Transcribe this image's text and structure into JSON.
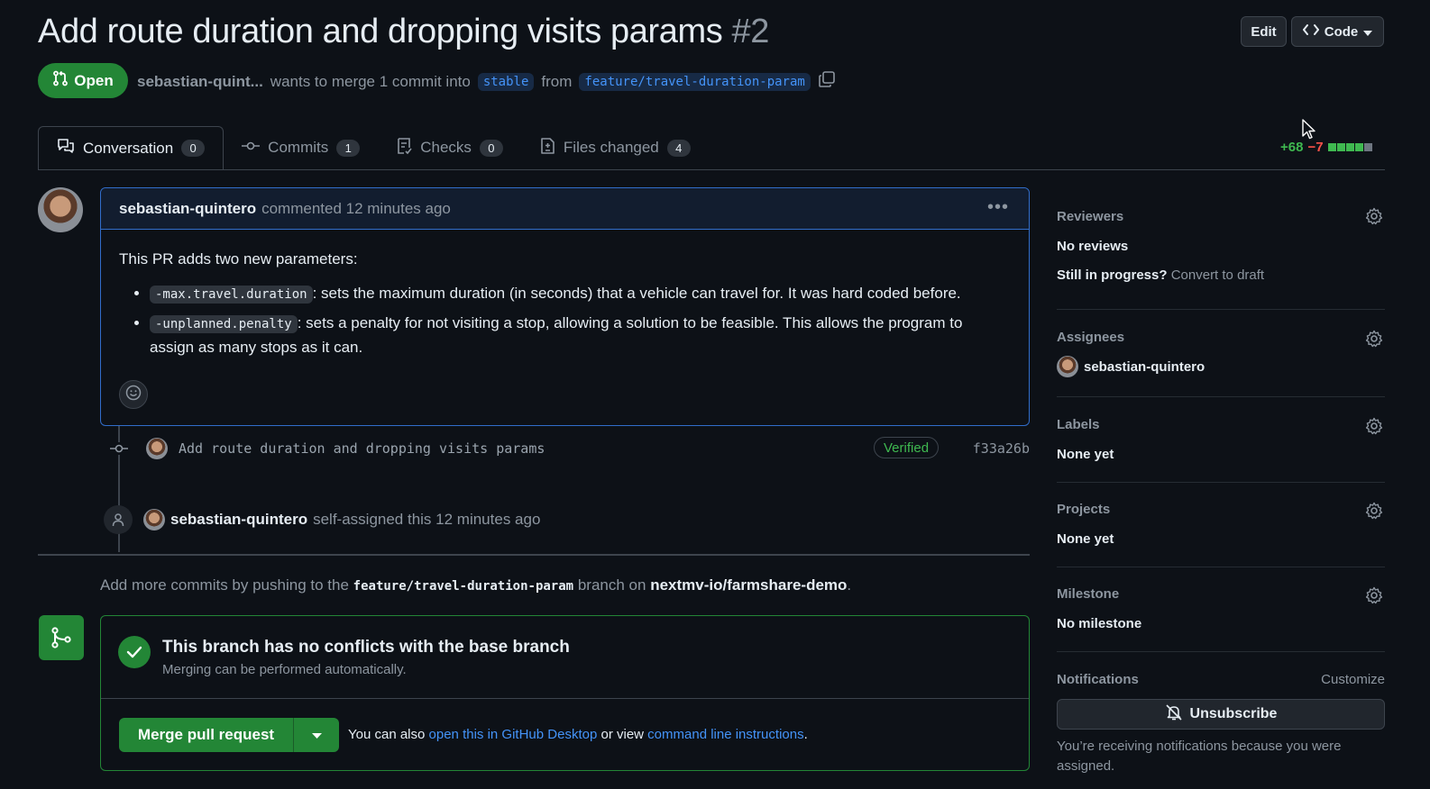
{
  "pr": {
    "title": "Add route duration and dropping visits params",
    "number": "#2",
    "state": "Open",
    "author": "sebastian-quint...",
    "merge_text": "wants to merge 1 commit into",
    "base_branch": "stable",
    "from_text": "from",
    "head_branch": "feature/travel-duration-param"
  },
  "header": {
    "edit_label": "Edit",
    "code_label": "Code"
  },
  "tabs": [
    {
      "label": "Conversation",
      "count": "0"
    },
    {
      "label": "Commits",
      "count": "1"
    },
    {
      "label": "Checks",
      "count": "0"
    },
    {
      "label": "Files changed",
      "count": "4"
    }
  ],
  "diffstat": {
    "additions": "+68",
    "deletions": "−7",
    "blocks": [
      "#3fb950",
      "#3fb950",
      "#3fb950",
      "#3fb950",
      "#6e7681"
    ]
  },
  "comment": {
    "author": "sebastian-quintero",
    "meta": "commented 12 minutes ago",
    "intro": "This PR adds two new parameters:",
    "items": [
      {
        "code": "-max.travel.duration",
        "text": ": sets the maximum duration (in seconds) that a vehicle can travel for. It was hard coded before."
      },
      {
        "code": "-unplanned.penalty",
        "text": ": sets a penalty for not visiting a stop, allowing a solution to be feasible. This allows the program to assign as many stops as it can."
      }
    ]
  },
  "commit": {
    "message": "Add route duration and dropping visits params",
    "verified": "Verified",
    "sha": "f33a26b"
  },
  "assign_event": {
    "user": "sebastian-quintero",
    "text": "self-assigned this 12 minutes ago"
  },
  "push_hint": {
    "prefix": "Add more commits by pushing to the",
    "branch": "feature/travel-duration-param",
    "middle": "branch on",
    "repo": "nextmv-io/farmshare-demo",
    "suffix": "."
  },
  "merge": {
    "title": "This branch has no conflicts with the base branch",
    "subtitle": "Merging can be performed automatically.",
    "button": "Merge pull request",
    "note_prefix": "You can also",
    "desktop_link": "open this in GitHub Desktop",
    "note_middle": "or view",
    "cli_link": "command line instructions",
    "note_suffix": "."
  },
  "sidebar": {
    "reviewers": {
      "label": "Reviewers",
      "value": "No reviews",
      "draft_q": "Still in progress?",
      "draft_link": "Convert to draft"
    },
    "assignees": {
      "label": "Assignees",
      "value": "sebastian-quintero"
    },
    "labels": {
      "label": "Labels",
      "value": "None yet"
    },
    "projects": {
      "label": "Projects",
      "value": "None yet"
    },
    "milestone": {
      "label": "Milestone",
      "value": "No milestone"
    },
    "notifications": {
      "label": "Notifications",
      "customize": "Customize",
      "button": "Unsubscribe",
      "note": "You’re receiving notifications because you were assigned."
    }
  }
}
